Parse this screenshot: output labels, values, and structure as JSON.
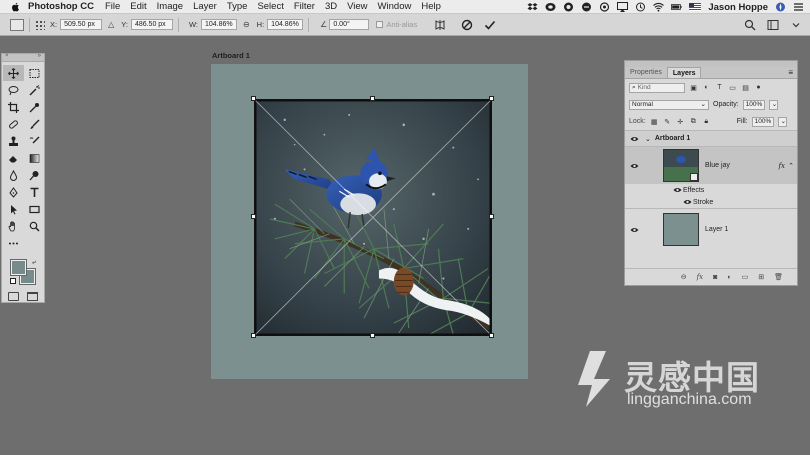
{
  "menubar": {
    "app_name": "Photoshop CC",
    "menus": [
      "File",
      "Edit",
      "Image",
      "Layer",
      "Type",
      "Select",
      "Filter",
      "3D",
      "View",
      "Window",
      "Help"
    ],
    "user": "Jason Hoppe",
    "status_icons": [
      "dropbox-icon",
      "creative-cloud-icon",
      "wifi-icon",
      "battery-icon",
      "flag-icon",
      "user-name",
      "compass-icon",
      "list-icon"
    ]
  },
  "options_bar": {
    "x_label": "X:",
    "x_value": "509.50 px",
    "y_label": "Y:",
    "y_value": "486.50 px",
    "w_label": "W:",
    "w_value": "104.86%",
    "h_label": "H:",
    "h_value": "104.86%",
    "angle_value": "0.00",
    "angle_unit": "°",
    "antialias_label": "Anti-alias"
  },
  "canvas": {
    "artboard_label": "Artboard 1",
    "artboard_color": "#7b908f"
  },
  "layers_panel": {
    "tabs": [
      "Properties",
      "Layers"
    ],
    "active_tab": "Layers",
    "filter_label": "Kind",
    "blend_mode": "Normal",
    "opacity_label": "Opacity:",
    "opacity_value": "100%",
    "lock_label": "Lock:",
    "fill_label": "Fill:",
    "fill_value": "100%",
    "artboard_name": "Artboard 1",
    "layers": [
      {
        "name": "Blue jay",
        "fx": "fx",
        "effects_label": "Effects",
        "stroke_label": "Stroke"
      },
      {
        "name": "Layer 1"
      }
    ]
  },
  "watermark": {
    "text": "灵感中国",
    "url": "lingganchina.com"
  }
}
